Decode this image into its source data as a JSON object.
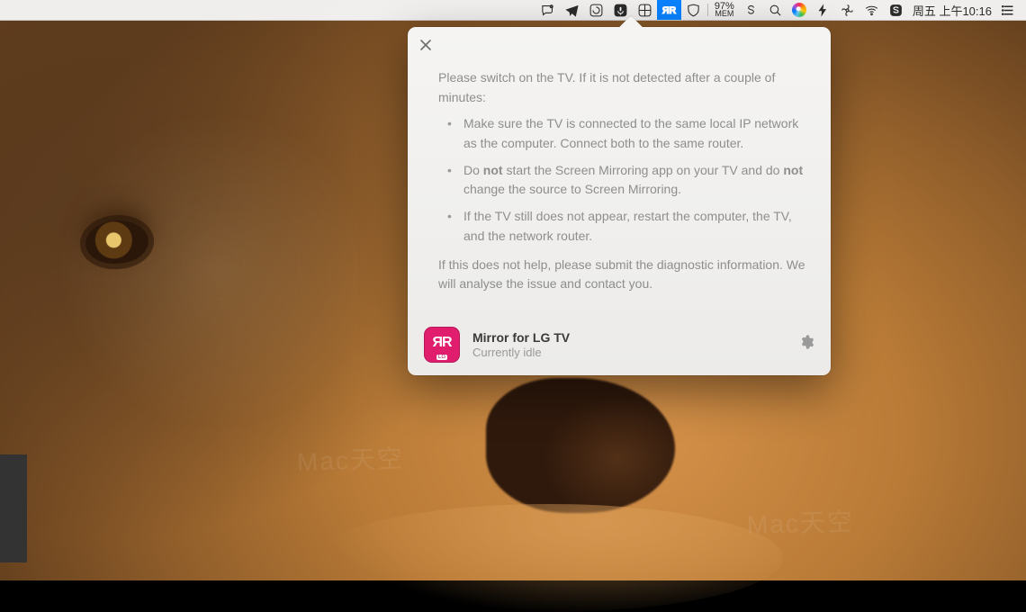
{
  "menubar": {
    "mem_pct": "97%",
    "mem_label": "MEM",
    "clock": "周五 上午10:16"
  },
  "popover": {
    "intro": "Please switch on the TV. If it is not detected after a couple of minutes:",
    "bullets": {
      "b1": "Make sure the TV is connected to the same local IP network as the computer. Connect both to the same router.",
      "b2_pre": "Do ",
      "b2_not1": "not",
      "b2_mid": " start the Screen Mirroring app on your TV and do ",
      "b2_not2": "not",
      "b2_post": " change the source to Screen Mirroring.",
      "b3": "If the TV still does not appear, restart the computer, the TV, and the network router."
    },
    "outro": "If this does not help, please submit the diagnostic information. We will analyse the issue and contact you.",
    "app_title": "Mirror for LG TV",
    "app_status": "Currently idle",
    "app_icon_badge": "LG"
  }
}
